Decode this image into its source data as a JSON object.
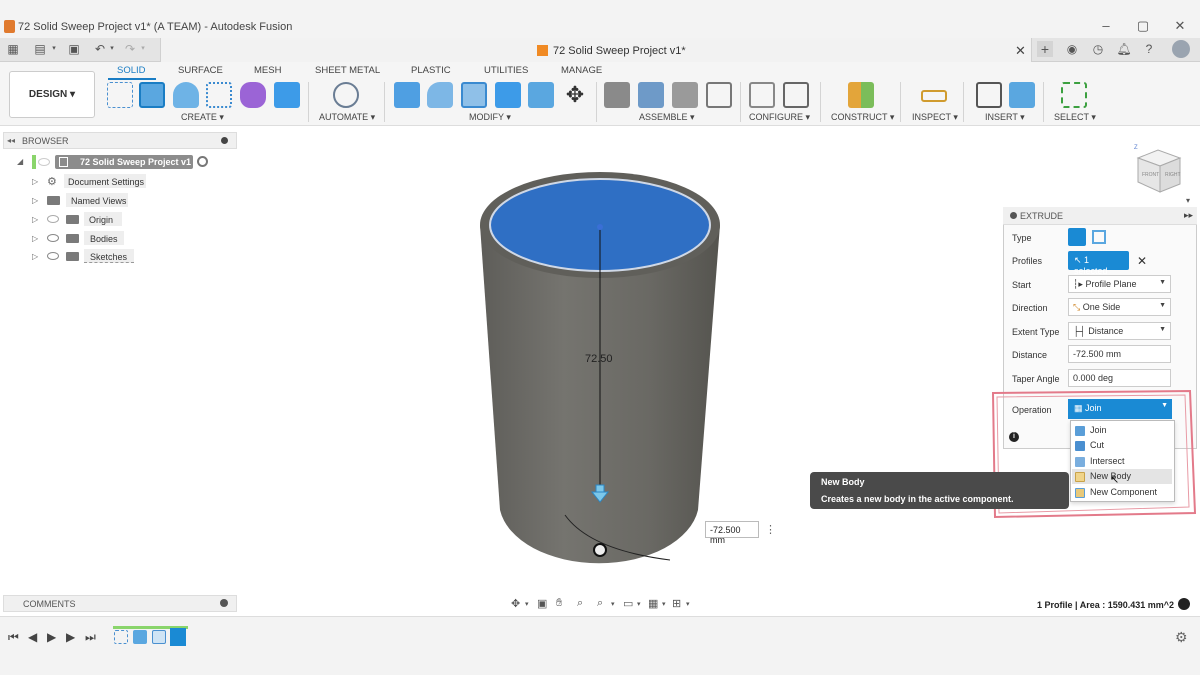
{
  "window": {
    "title": "72 Solid Sweep Project v1* (A TEAM) - Autodesk Fusion"
  },
  "document_tab": {
    "title": "72 Solid Sweep Project v1*"
  },
  "workspace": {
    "label": "DESIGN ▾"
  },
  "ribbon": {
    "tabs": [
      "SOLID",
      "SURFACE",
      "MESH",
      "SHEET METAL",
      "PLASTIC",
      "UTILITIES",
      "MANAGE"
    ],
    "groups": [
      "CREATE ▾",
      "AUTOMATE ▾",
      "MODIFY ▾",
      "ASSEMBLE ▾",
      "CONFIGURE ▾",
      "CONSTRUCT ▾",
      "INSPECT ▾",
      "INSERT ▾",
      "SELECT ▾"
    ]
  },
  "browser": {
    "title": "BROWSER",
    "root": "72 Solid Sweep Project v1",
    "items": [
      "Document Settings",
      "Named Views",
      "Origin",
      "Bodies",
      "Sketches"
    ]
  },
  "comments": {
    "label": "COMMENTS"
  },
  "viewport": {
    "dimension_label": "72.50",
    "dimension_input": "-72.500 mm",
    "status": "1 Profile | Area : 1590.431 mm^2"
  },
  "viewcube": {
    "front": "FRONT",
    "right": "RIGHT",
    "axis": "Z"
  },
  "extrude": {
    "title": "EXTRUDE",
    "labels": {
      "type": "Type",
      "profiles": "Profiles",
      "start": "Start",
      "direction": "Direction",
      "extent_type": "Extent Type",
      "distance": "Distance",
      "taper_angle": "Taper Angle",
      "operation": "Operation"
    },
    "profiles_value": "1 selected",
    "start_value": "Profile Plane",
    "direction_value": "One Side",
    "extent_value": "Distance",
    "distance_value": "-72.500 mm",
    "taper_value": "0.000 deg",
    "operation_value": "Join",
    "operation_options": [
      "Join",
      "Cut",
      "Intersect",
      "New Body",
      "New Component"
    ]
  },
  "tooltip": {
    "title": "New Body",
    "description": "Creates a new body in the active component."
  },
  "colors": {
    "accent": "#1a8ad4",
    "cylinder": "#6b6a66",
    "face": "#2f6fc4",
    "annotation": "#e37a8a"
  }
}
